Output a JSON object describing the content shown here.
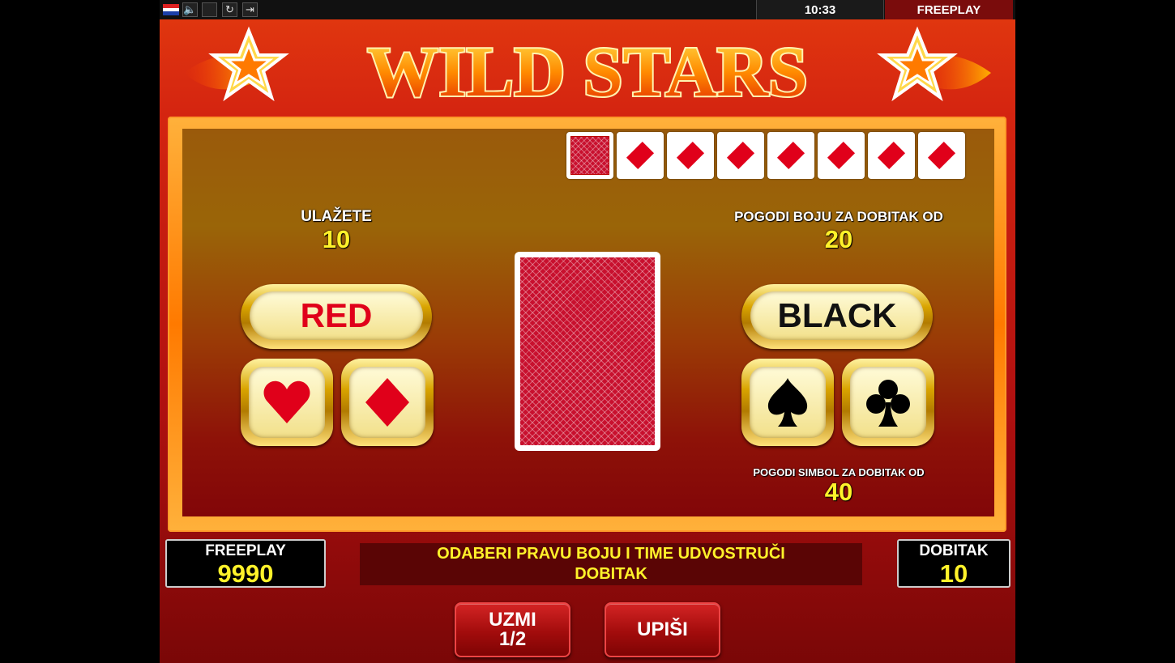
{
  "topbar": {
    "flag": "croatia-flag",
    "icons": [
      "sound-icon",
      "fullscreen-icon",
      "refresh-icon",
      "exit-icon"
    ],
    "clock": "10:33",
    "mode": "FREEPLAY"
  },
  "logo": {
    "text": "WILD STARS"
  },
  "history": {
    "cards": [
      {
        "type": "back"
      },
      {
        "suit": "diamond"
      },
      {
        "suit": "diamond"
      },
      {
        "suit": "diamond"
      },
      {
        "suit": "diamond"
      },
      {
        "suit": "diamond"
      },
      {
        "suit": "diamond"
      },
      {
        "suit": "diamond"
      }
    ]
  },
  "gamble": {
    "stake_label": "ULAŽETE",
    "stake_value": "10",
    "color_win_label": "POGODI BOJU ZA DOBITAK OD",
    "color_win_value": "20",
    "suit_win_label": "POGODI SIMBOL ZA DOBITAK OD",
    "suit_win_value": "40",
    "red_label": "RED",
    "black_label": "BLACK",
    "suits_left": [
      "heart-icon",
      "diamond-icon"
    ],
    "suits_right": [
      "spade-icon",
      "club-icon"
    ]
  },
  "meters": {
    "credit_label": "FREEPLAY",
    "credit_value": "9990",
    "win_label": "DOBITAK",
    "win_value": "10"
  },
  "message": "ODABERI PRAVU BOJU I TIME UDVOSTRUČI DOBITAK",
  "buttons": {
    "take_line1": "UZMI",
    "take_line2": "1/2",
    "collect": "UPIŠI"
  },
  "colors": {
    "accent_yellow": "#fff22a",
    "card_red": "#c8102e",
    "suit_red": "#e0001a"
  }
}
